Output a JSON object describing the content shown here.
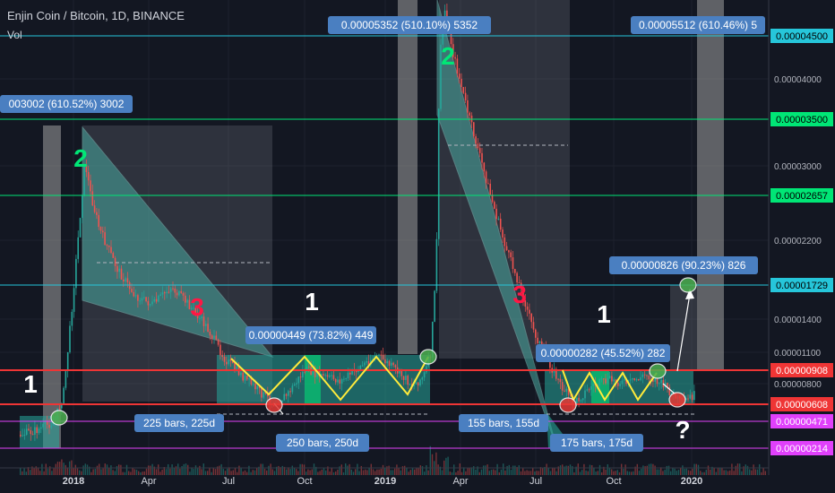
{
  "header": {
    "title": "Enjin Coin / Bitcoin, 1D, BINANCE",
    "volume_label": "Vol"
  },
  "colors": {
    "background": "#131722",
    "up": "#26a69a",
    "down": "#ef5350",
    "box": "#26a69a",
    "gray": "#9598a1",
    "zigzag": "#ffeb3b",
    "label_bg": "#4a7fc1"
  },
  "chart_data": {
    "type": "candlestick",
    "symbol": "Enjin Coin / Bitcoin",
    "interval": "1D",
    "exchange": "BINANCE",
    "ylim": [
      1e-06,
      4.8e-06
    ],
    "price_levels": [
      {
        "value": 4.5e-05,
        "label": "0.00004500",
        "color": "#26c6da"
      },
      {
        "value": 3.5e-05,
        "label": "0.00003500",
        "color": "#00e676"
      },
      {
        "value": 2.657e-05,
        "label": "0.00002657",
        "color": "#00e676"
      },
      {
        "value": 1.729e-05,
        "label": "0.00001729",
        "color": "#26c6da"
      },
      {
        "value": 9.08e-06,
        "label": "0.00000908",
        "color": "#ef3535"
      },
      {
        "value": 6.08e-06,
        "label": "0.00000608",
        "color": "#ef3535"
      },
      {
        "value": 4.71e-06,
        "label": "0.00000471",
        "color": "#e040fb"
      },
      {
        "value": 2.14e-06,
        "label": "0.00000214",
        "color": "#e040fb"
      }
    ],
    "axis_ticks": [
      {
        "label": "0.00004000",
        "value": 4e-05
      },
      {
        "label": "0.00003000",
        "value": 3e-05
      },
      {
        "label": "0.00002200",
        "value": 2.2e-05
      },
      {
        "label": "0.00001400",
        "value": 1.4e-05
      },
      {
        "label": "0.00001100",
        "value": 1.1e-05
      },
      {
        "label": "0.00000800",
        "value": 8e-06
      }
    ],
    "x_labels": [
      "2018",
      "Apr",
      "Jul",
      "Oct",
      "2019",
      "Apr",
      "Jul",
      "Oct",
      "2020"
    ],
    "measurements": [
      "003002 (610.52%) 3002",
      "0.00005352 (510.10%) 5352",
      "0.00005512 (610.46%) 5",
      "0.00000449 (73.82%) 449",
      "0.00000282 (45.52%) 282",
      "0.00000826 (90.23%) 826"
    ],
    "bar_counts": [
      "225 bars, 225d",
      "250 bars, 250d",
      "155 bars, 155d",
      "175 bars, 175d"
    ],
    "wave_labels": [
      {
        "text": "1",
        "color": "#ffffff"
      },
      {
        "text": "2",
        "color": "#00e676"
      },
      {
        "text": "3",
        "color": "#ff1744"
      },
      {
        "text": "1",
        "color": "#ffffff"
      },
      {
        "text": "2",
        "color": "#00e676"
      },
      {
        "text": "3",
        "color": "#ff1744"
      },
      {
        "text": "1",
        "color": "#ffffff"
      },
      {
        "text": "?",
        "color": "#ffffff"
      }
    ]
  }
}
